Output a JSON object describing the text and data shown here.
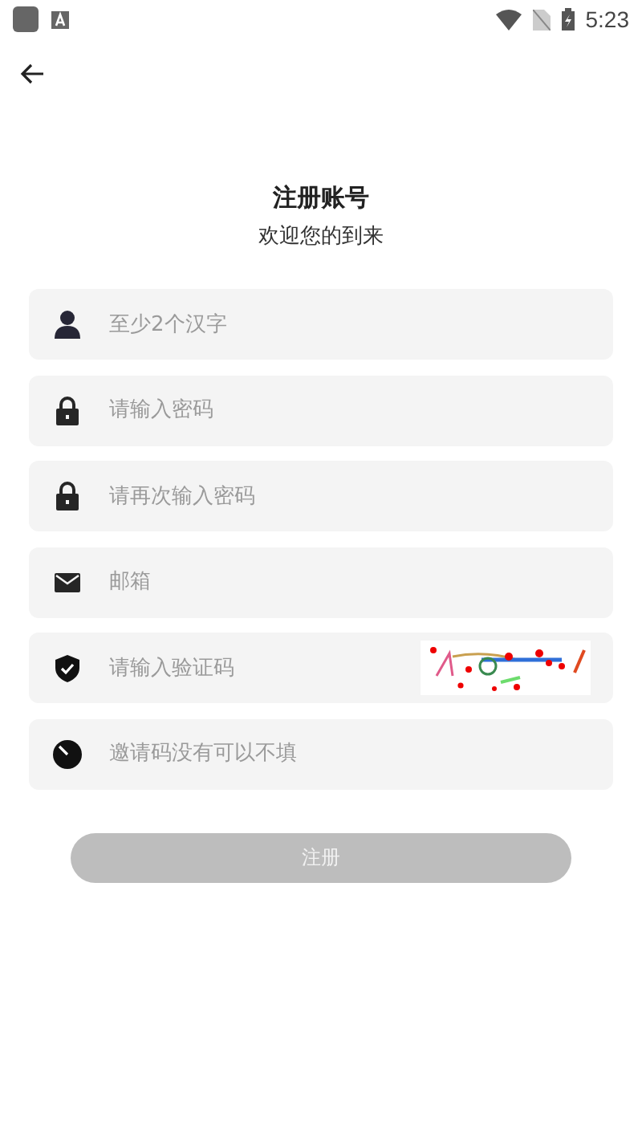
{
  "status_bar": {
    "time": "5:23"
  },
  "header": {
    "title": "注册账号",
    "subtitle": "欢迎您的到来"
  },
  "fields": [
    {
      "kind": "user",
      "placeholder": "至少2个汉字"
    },
    {
      "kind": "password",
      "placeholder": "请输入密码"
    },
    {
      "kind": "password",
      "placeholder": "请再次输入密码"
    },
    {
      "kind": "email",
      "placeholder": "邮箱"
    },
    {
      "kind": "captcha",
      "placeholder": "请输入验证码"
    },
    {
      "kind": "invite",
      "placeholder": "邀请码没有可以不填"
    }
  ],
  "submit": {
    "label": "注册",
    "disabled": true
  }
}
